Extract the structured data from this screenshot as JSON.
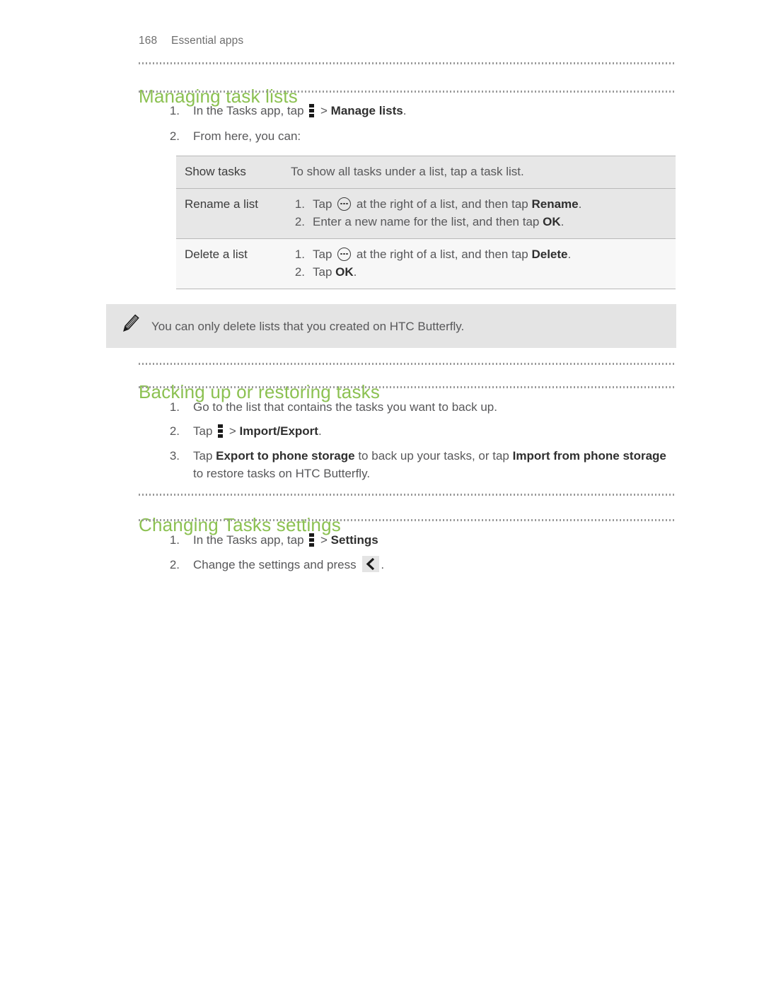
{
  "header": {
    "page_number": "168",
    "chapter": "Essential apps"
  },
  "sections": [
    {
      "heading": "Managing task lists",
      "steps": [
        {
          "num": "1.",
          "parts": [
            {
              "t": "text",
              "v": "In the Tasks app, tap "
            },
            {
              "t": "icon",
              "v": "kebab-menu-icon"
            },
            {
              "t": "text",
              "v": " > "
            },
            {
              "t": "bold",
              "v": "Manage lists"
            },
            {
              "t": "text",
              "v": "."
            }
          ]
        },
        {
          "num": "2.",
          "parts": [
            {
              "t": "text",
              "v": "From here, you can:"
            }
          ]
        }
      ]
    },
    {
      "heading": "Backing up or restoring tasks",
      "steps": [
        {
          "num": "1.",
          "parts": [
            {
              "t": "text",
              "v": "Go to the list that contains the tasks you want to back up."
            }
          ]
        },
        {
          "num": "2.",
          "parts": [
            {
              "t": "text",
              "v": "Tap "
            },
            {
              "t": "icon",
              "v": "kebab-menu-icon"
            },
            {
              "t": "text",
              "v": " > "
            },
            {
              "t": "bold",
              "v": "Import/Export"
            },
            {
              "t": "text",
              "v": "."
            }
          ]
        },
        {
          "num": "3.",
          "parts": [
            {
              "t": "text",
              "v": "Tap "
            },
            {
              "t": "bold",
              "v": "Export to phone storage"
            },
            {
              "t": "text",
              "v": " to back up your tasks, or tap "
            },
            {
              "t": "bold",
              "v": "Import from phone storage"
            },
            {
              "t": "text",
              "v": " to restore tasks on HTC Butterfly."
            }
          ]
        }
      ]
    },
    {
      "heading": "Changing Tasks settings",
      "steps": [
        {
          "num": "1.",
          "parts": [
            {
              "t": "text",
              "v": "In the Tasks app, tap "
            },
            {
              "t": "icon",
              "v": "kebab-menu-icon"
            },
            {
              "t": "text",
              "v": " > "
            },
            {
              "t": "bold",
              "v": "Settings"
            }
          ]
        },
        {
          "num": "2.",
          "parts": [
            {
              "t": "text",
              "v": "Change the settings and press "
            },
            {
              "t": "icon",
              "v": "back-arrow-icon"
            },
            {
              "t": "text",
              "v": "."
            }
          ]
        }
      ]
    }
  ],
  "table": {
    "rows": [
      {
        "label": "Show tasks",
        "lines": [
          {
            "num": "",
            "parts": [
              {
                "t": "text",
                "v": "To show all tasks under a list, tap a task list."
              }
            ]
          }
        ]
      },
      {
        "label": "Rename a list",
        "lines": [
          {
            "num": "1.",
            "parts": [
              {
                "t": "text",
                "v": "Tap "
              },
              {
                "t": "icon",
                "v": "overflow-circle-icon"
              },
              {
                "t": "text",
                "v": " at the right of a list, and then tap "
              },
              {
                "t": "bold",
                "v": "Rename"
              },
              {
                "t": "text",
                "v": "."
              }
            ]
          },
          {
            "num": "2.",
            "parts": [
              {
                "t": "text",
                "v": "Enter a new name for the list, and then tap "
              },
              {
                "t": "bold",
                "v": "OK"
              },
              {
                "t": "text",
                "v": "."
              }
            ]
          }
        ]
      },
      {
        "label": "Delete a list",
        "lines": [
          {
            "num": "1.",
            "parts": [
              {
                "t": "text",
                "v": "Tap "
              },
              {
                "t": "icon",
                "v": "overflow-circle-icon"
              },
              {
                "t": "text",
                "v": " at the right of a list, and then tap "
              },
              {
                "t": "bold",
                "v": "Delete"
              },
              {
                "t": "text",
                "v": "."
              }
            ]
          },
          {
            "num": "2.",
            "parts": [
              {
                "t": "text",
                "v": "Tap "
              },
              {
                "t": "bold",
                "v": "OK"
              },
              {
                "t": "text",
                "v": "."
              }
            ]
          }
        ]
      }
    ]
  },
  "note": {
    "icon": "pencil-icon",
    "text": "You can only delete lists that you created on HTC Butterfly."
  },
  "colors": {
    "heading_green": "#8cc152",
    "body_text": "#58585a",
    "bold_text": "#2f2f2f",
    "table_row_bg": "#e7e7e7",
    "table_last_row_bg": "#f7f7f7",
    "note_bg": "#e4e4e4",
    "rule_dot": "#9b9b9b"
  }
}
